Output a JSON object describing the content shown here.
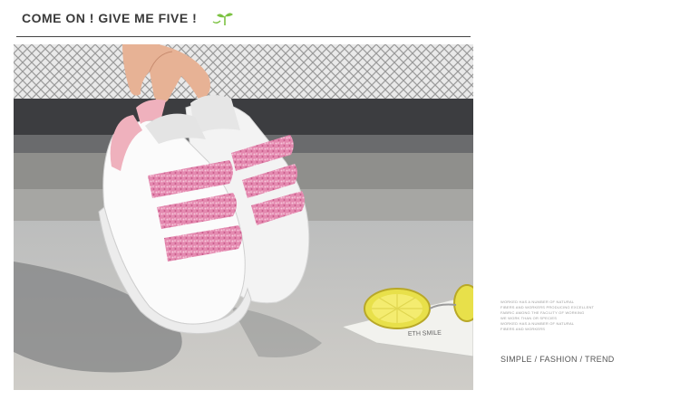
{
  "header": {
    "title": "COME ON ! GIVE ME FIVE !",
    "icon": "sprout-icon",
    "accent_color": "#7cc242"
  },
  "photo": {
    "subject": "shoe-photo",
    "card_text": "ETH SMILE"
  },
  "side_note": {
    "lines": [
      "WORKED HAS A NUMBER OF NATURAL",
      "FIBERS AND WORKERS PRODUCING EXCELLENT",
      "FABRIC AMONG THE FACILITY OF WORKING",
      "WE WORK THAN OR SPECIES",
      "WORKED HAS A NUMBER OF NATURAL",
      "FIBERS AND WORKERS"
    ],
    "tagline": "SIMPLE / FASHION / TREND"
  }
}
